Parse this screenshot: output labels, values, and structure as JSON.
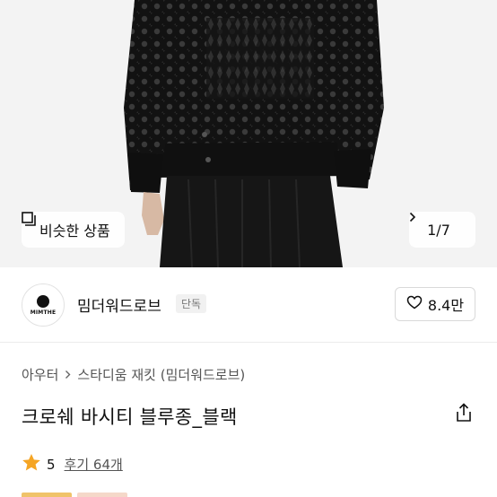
{
  "hero": {
    "similar_button_label": "비슷한 상품",
    "image_counter": "1/7"
  },
  "brand": {
    "logo_text": "MIMTHE",
    "name": "밈더워드로브",
    "badge": "단독",
    "like_count": "8.4만"
  },
  "breadcrumb": {
    "category": "아우터",
    "subcategory": "스타디움 재킷 (밈더워드로브)"
  },
  "product": {
    "title": "크로쉐 바시티 블루종_블랙"
  },
  "rating": {
    "score": "5",
    "reviews_label": "후기 64개"
  },
  "colors": {
    "star": "#f5a524",
    "tag1": "#f0c36a",
    "tag2": "#f5d8c9"
  }
}
